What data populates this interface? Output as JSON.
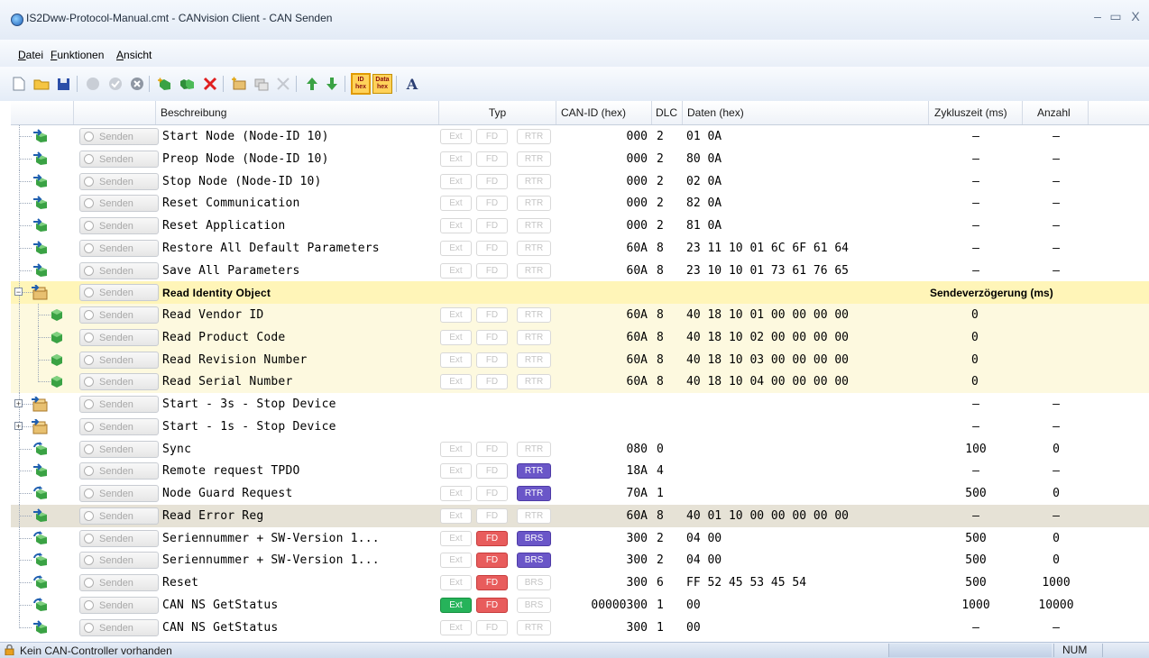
{
  "window": {
    "title": "IS2Dww-Protocol-Manual.cmt - CANvision Client - CAN Senden"
  },
  "menu": [
    {
      "label": "Datei"
    },
    {
      "label": "Funktionen"
    },
    {
      "label": "Ansicht"
    }
  ],
  "toolbar": {
    "id_hex": "ID\nhex",
    "data_hex": "Data\nhex",
    "font": "A"
  },
  "columns": {
    "beschreibung": "Beschreibung",
    "typ": "Typ",
    "canid": "CAN-ID (hex)",
    "dlc": "DLC",
    "daten": "Daten (hex)",
    "zyklus": "Zykluszeit (ms)",
    "anzahl": "Anzahl"
  },
  "send_label": "Senden",
  "badge_labels": {
    "ext": "Ext",
    "fd": "FD",
    "rtr": "RTR",
    "brs": "BRS"
  },
  "group_extra": "Sendeverzögerung (ms)",
  "rows": [
    {
      "kind": "msg",
      "desc": "Start Node (Node-ID 10)",
      "ext": false,
      "fd": false,
      "third": "RTR",
      "third_on": false,
      "canid": "000",
      "dlc": "2",
      "data": "01 0A",
      "zyklus": "–",
      "anzahl": "–",
      "icon": "arrow"
    },
    {
      "kind": "msg",
      "desc": "Preop Node (Node-ID 10)",
      "ext": false,
      "fd": false,
      "third": "RTR",
      "third_on": false,
      "canid": "000",
      "dlc": "2",
      "data": "80 0A",
      "zyklus": "–",
      "anzahl": "–",
      "icon": "arrow"
    },
    {
      "kind": "msg",
      "desc": "Stop Node (Node-ID 10)",
      "ext": false,
      "fd": false,
      "third": "RTR",
      "third_on": false,
      "canid": "000",
      "dlc": "2",
      "data": "02 0A",
      "zyklus": "–",
      "anzahl": "–",
      "icon": "arrow"
    },
    {
      "kind": "msg",
      "desc": "Reset Communication",
      "ext": false,
      "fd": false,
      "third": "RTR",
      "third_on": false,
      "canid": "000",
      "dlc": "2",
      "data": "82 0A",
      "zyklus": "–",
      "anzahl": "–",
      "icon": "arrow"
    },
    {
      "kind": "msg",
      "desc": "Reset Application",
      "ext": false,
      "fd": false,
      "third": "RTR",
      "third_on": false,
      "canid": "000",
      "dlc": "2",
      "data": "81 0A",
      "zyklus": "–",
      "anzahl": "–",
      "icon": "arrow"
    },
    {
      "kind": "msg",
      "desc": "Restore All Default Parameters",
      "ext": false,
      "fd": false,
      "third": "RTR",
      "third_on": false,
      "canid": "60A",
      "dlc": "8",
      "data": "23 11 10 01 6C 6F 61 64",
      "zyklus": "–",
      "anzahl": "–",
      "icon": "arrow"
    },
    {
      "kind": "msg",
      "desc": "Save All Parameters",
      "ext": false,
      "fd": false,
      "third": "RTR",
      "third_on": false,
      "canid": "60A",
      "dlc": "8",
      "data": "23 10 10 01 73 61 76 65",
      "zyklus": "–",
      "anzahl": "–",
      "icon": "arrow"
    },
    {
      "kind": "group",
      "desc": "Read Identity Object",
      "expander": "−",
      "icon": "group"
    },
    {
      "kind": "child",
      "desc": "Read Vendor ID",
      "ext": false,
      "fd": false,
      "third": "RTR",
      "third_on": false,
      "canid": "60A",
      "dlc": "8",
      "data": "40 18 10 01 00 00 00 00",
      "delay": "0",
      "icon": "dot"
    },
    {
      "kind": "child",
      "desc": "Read Product Code",
      "ext": false,
      "fd": false,
      "third": "RTR",
      "third_on": false,
      "canid": "60A",
      "dlc": "8",
      "data": "40 18 10 02 00 00 00 00",
      "delay": "0",
      "icon": "dot"
    },
    {
      "kind": "child",
      "desc": "Read Revision Number",
      "ext": false,
      "fd": false,
      "third": "RTR",
      "third_on": false,
      "canid": "60A",
      "dlc": "8",
      "data": "40 18 10 03 00 00 00 00",
      "delay": "0",
      "icon": "dot"
    },
    {
      "kind": "child",
      "desc": "Read Serial Number",
      "ext": false,
      "fd": false,
      "third": "RTR",
      "third_on": false,
      "canid": "60A",
      "dlc": "8",
      "data": "40 18 10 04 00 00 00 00",
      "delay": "0",
      "icon": "dot"
    },
    {
      "kind": "groupc",
      "desc": "Start - 3s - Stop Device",
      "expander": "+",
      "zyklus": "–",
      "anzahl": "–",
      "icon": "group"
    },
    {
      "kind": "groupc",
      "desc": "Start - 1s - Stop Device",
      "expander": "+",
      "zyklus": "–",
      "anzahl": "–",
      "icon": "group"
    },
    {
      "kind": "msg",
      "desc": "Sync",
      "ext": false,
      "fd": false,
      "third": "RTR",
      "third_on": false,
      "canid": "080",
      "dlc": "0",
      "data": "",
      "zyklus": "100",
      "anzahl": "0",
      "icon": "cycle"
    },
    {
      "kind": "msg",
      "desc": "Remote request TPDO",
      "ext": false,
      "fd": false,
      "third": "RTR",
      "third_on": true,
      "canid": "18A",
      "dlc": "4",
      "data": "",
      "zyklus": "–",
      "anzahl": "–",
      "icon": "arrow"
    },
    {
      "kind": "msg",
      "desc": "Node Guard Request",
      "ext": false,
      "fd": false,
      "third": "RTR",
      "third_on": true,
      "canid": "70A",
      "dlc": "1",
      "data": "",
      "zyklus": "500",
      "anzahl": "0",
      "icon": "cycle"
    },
    {
      "kind": "msg",
      "desc": "Read Error Reg",
      "ext": false,
      "fd": false,
      "third": "RTR",
      "third_on": false,
      "canid": "60A",
      "dlc": "8",
      "data": "40 01 10 00 00 00 00 00",
      "zyklus": "–",
      "anzahl": "–",
      "icon": "arrow",
      "selected": true
    },
    {
      "kind": "msg",
      "desc": "Seriennummer + SW-Version 1...",
      "ext": false,
      "fd": true,
      "third": "BRS",
      "third_on": true,
      "canid": "300",
      "dlc": "2",
      "data": "04 00",
      "zyklus": "500",
      "anzahl": "0",
      "icon": "cycle"
    },
    {
      "kind": "msg",
      "desc": "Seriennummer + SW-Version 1...",
      "ext": false,
      "fd": true,
      "third": "BRS",
      "third_on": true,
      "canid": "300",
      "dlc": "2",
      "data": "04 00",
      "zyklus": "500",
      "anzahl": "0",
      "icon": "cycle"
    },
    {
      "kind": "msg",
      "desc": "Reset",
      "ext": false,
      "fd": true,
      "third": "BRS",
      "third_on": false,
      "canid": "300",
      "dlc": "6",
      "data": "FF 52 45 53 45 54",
      "zyklus": "500",
      "anzahl": "1000",
      "icon": "cycle"
    },
    {
      "kind": "msg",
      "desc": "CAN NS GetStatus",
      "ext": true,
      "fd": true,
      "third": "BRS",
      "third_on": false,
      "canid": "00000300",
      "dlc": "1",
      "data": "00",
      "zyklus": "1000",
      "anzahl": "10000",
      "icon": "cycle"
    },
    {
      "kind": "msg",
      "desc": "CAN NS GetStatus",
      "ext": false,
      "fd": false,
      "third": "RTR",
      "third_on": false,
      "canid": "300",
      "dlc": "1",
      "data": "00",
      "zyklus": "–",
      "anzahl": "–",
      "icon": "arrow",
      "last": true
    }
  ],
  "status": {
    "text": "Kein CAN-Controller vorhanden",
    "num": "NUM"
  }
}
